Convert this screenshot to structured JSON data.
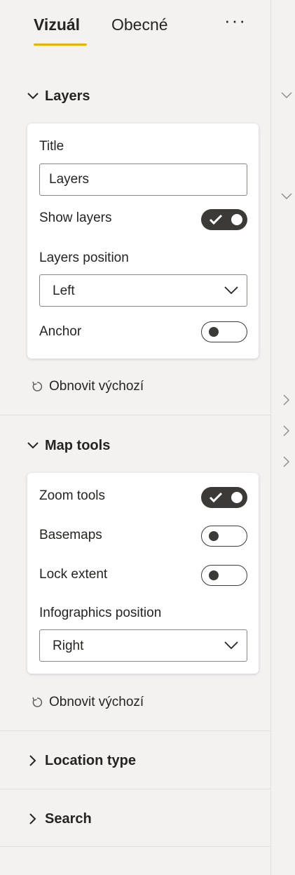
{
  "tabs": {
    "visual": "Vizuál",
    "general": "Obecné",
    "more": "···"
  },
  "layers": {
    "header": "Layers",
    "title_label": "Title",
    "title_value": "Layers",
    "show_layers_label": "Show layers",
    "show_layers_on": true,
    "position_label": "Layers position",
    "position_value": "Left",
    "anchor_label": "Anchor",
    "anchor_on": false,
    "reset": "Obnovit výchozí"
  },
  "map_tools": {
    "header": "Map tools",
    "zoom_label": "Zoom tools",
    "zoom_on": true,
    "basemaps_label": "Basemaps",
    "basemaps_on": false,
    "lock_label": "Lock extent",
    "lock_on": false,
    "infographics_label": "Infographics position",
    "infographics_value": "Right",
    "reset": "Obnovit výchozí"
  },
  "location_type": {
    "header": "Location type"
  },
  "search": {
    "header": "Search"
  },
  "colors": {
    "accent": "#e8b300",
    "toggle_on": "#3b3a39",
    "panel_bg": "#f3f2f1"
  }
}
